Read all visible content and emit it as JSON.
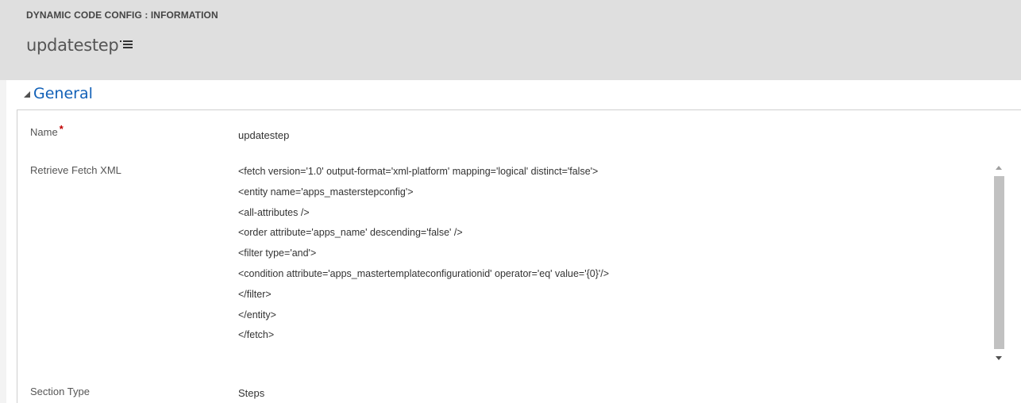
{
  "header": {
    "entity_label": "DYNAMIC CODE CONFIG : INFORMATION",
    "record_title": "updatestep",
    "menu_icon": "list-menu-icon"
  },
  "section": {
    "title": "General",
    "collapse_icon": "collapse-triangle-icon"
  },
  "fields": {
    "name": {
      "label": "Name",
      "required_marker": "*",
      "value": "updatestep"
    },
    "fetch_xml": {
      "label": "Retrieve Fetch XML",
      "lines": [
        "<fetch version='1.0' output-format='xml-platform' mapping='logical' distinct='false'>",
        "<entity name='apps_masterstepconfig'>",
        "<all-attributes />",
        "<order attribute='apps_name' descending='false' />",
        "<filter type='and'>",
        "<condition attribute='apps_mastertemplateconfigurationid' operator='eq' value='{0}'/>",
        "</filter>",
        "</entity>",
        "</fetch>"
      ]
    },
    "section_type": {
      "label": "Section Type",
      "value": "Steps"
    }
  },
  "colors": {
    "header_bg": "#dfdfdf",
    "section_title": "#1160b7",
    "required": "#c00000"
  }
}
